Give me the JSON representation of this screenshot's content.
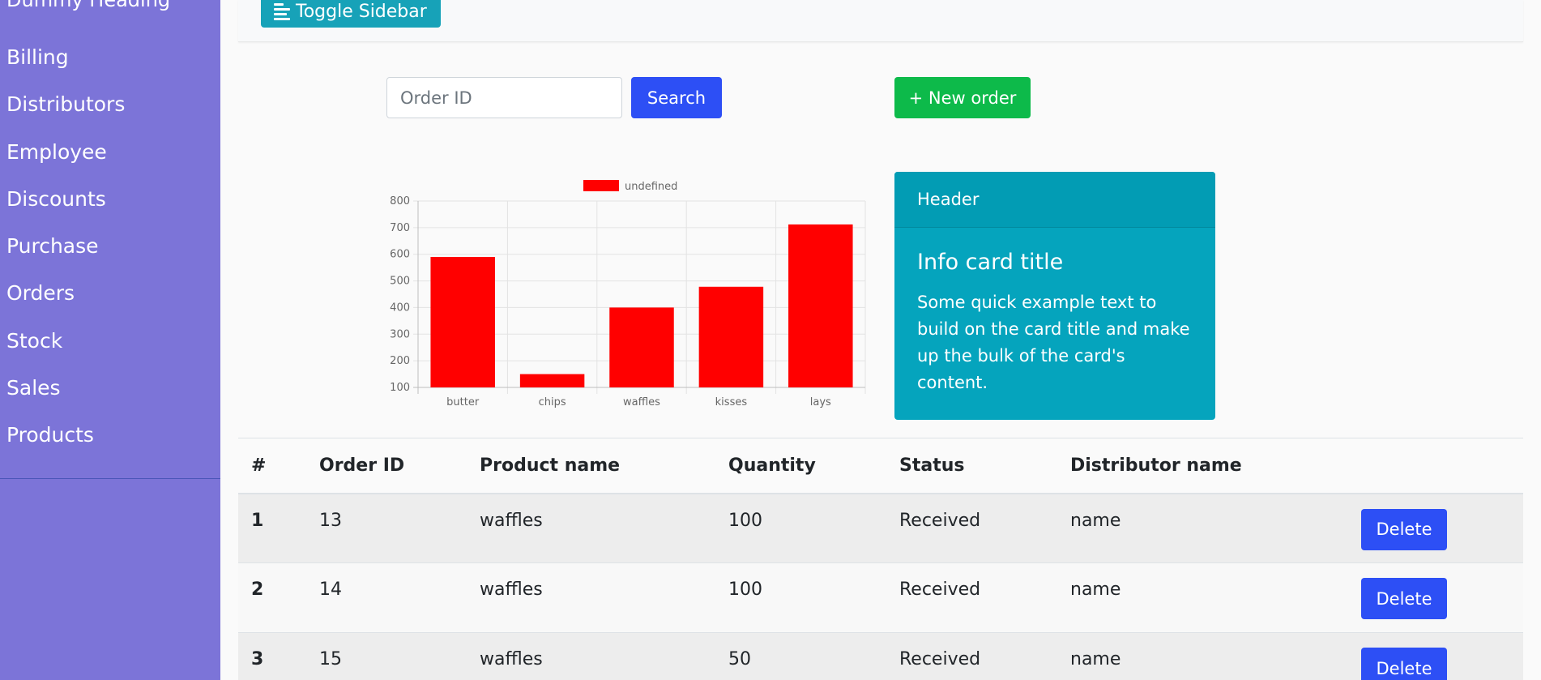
{
  "sidebar": {
    "heading": "Dummy Heading",
    "items": [
      {
        "label": "Billing"
      },
      {
        "label": "Distributors"
      },
      {
        "label": "Employee"
      },
      {
        "label": "Discounts"
      },
      {
        "label": "Purchase"
      },
      {
        "label": "Orders"
      },
      {
        "label": "Stock"
      },
      {
        "label": "Sales"
      },
      {
        "label": "Products"
      }
    ]
  },
  "navbar": {
    "toggle_label": "Toggle Sidebar"
  },
  "search": {
    "placeholder": "Order ID",
    "button_label": "Search"
  },
  "new_order_label": "+ New order",
  "colors": {
    "sidebar_bg": "#7c74d8",
    "primary": "#2d4ff5",
    "success": "#0dba4a",
    "info": "#05a4bd",
    "bar": "#ff0000"
  },
  "chart_data": {
    "type": "bar",
    "categories": [
      "butter",
      "chips",
      "waffles",
      "kisses",
      "lays"
    ],
    "series": [
      {
        "name": "undefined",
        "values": [
          590,
          150,
          400,
          478,
          712
        ]
      }
    ],
    "ylim": [
      100,
      800
    ],
    "yticks": [
      100,
      200,
      300,
      400,
      500,
      600,
      700,
      800
    ],
    "grid": true,
    "legend": "top-center"
  },
  "info_card": {
    "header": "Header",
    "title": "Info card title",
    "text": "Some quick example text to build on the card title and make up the bulk of the card's content."
  },
  "table": {
    "headers": [
      "#",
      "Order ID",
      "Product name",
      "Quantity",
      "Status",
      "Distributor name",
      ""
    ],
    "rows": [
      {
        "num": "1",
        "order_id": "13",
        "product": "waffles",
        "quantity": "100",
        "status": "Received",
        "distributor": "name",
        "action": "Delete"
      },
      {
        "num": "2",
        "order_id": "14",
        "product": "waffles",
        "quantity": "100",
        "status": "Received",
        "distributor": "name",
        "action": "Delete"
      },
      {
        "num": "3",
        "order_id": "15",
        "product": "waffles",
        "quantity": "50",
        "status": "Received",
        "distributor": "name",
        "action": "Delete"
      }
    ]
  }
}
